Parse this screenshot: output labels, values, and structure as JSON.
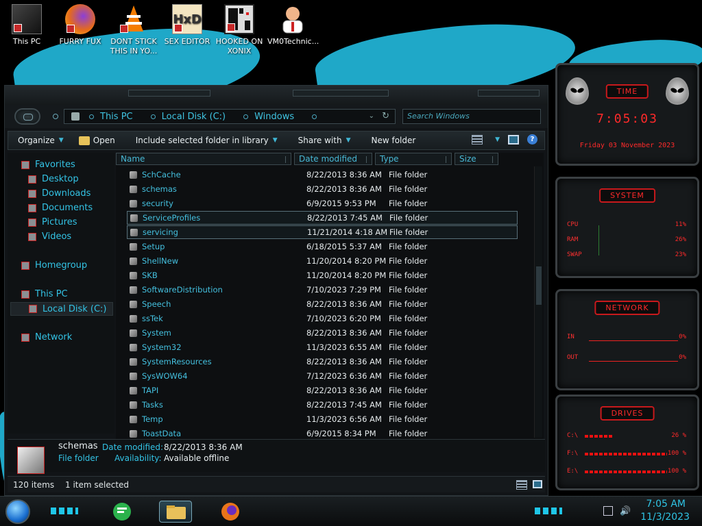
{
  "desktop": {
    "icons": [
      {
        "label": "This PC"
      },
      {
        "label": "FURRY FUX"
      },
      {
        "label": "DONT STICK THIS IN YO..."
      },
      {
        "label": "SEX EDITOR"
      },
      {
        "label": "HOOKED ON XONIX"
      },
      {
        "label": "VM0Technic..."
      }
    ]
  },
  "address": {
    "crumbs": [
      "This PC",
      "Local Disk (C:)",
      "Windows"
    ],
    "search_placeholder": "Search Windows"
  },
  "toolbar": {
    "organize": "Organize",
    "open": "Open",
    "include": "Include selected folder in library",
    "share": "Share with",
    "new_folder": "New folder",
    "help": "?"
  },
  "nav": {
    "favorites": "Favorites",
    "desktop": "Desktop",
    "downloads": "Downloads",
    "documents": "Documents",
    "pictures": "Pictures",
    "videos": "Videos",
    "homegroup": "Homegroup",
    "this_pc": "This PC",
    "local_disk": "Local Disk (C:)",
    "network": "Network"
  },
  "columns": {
    "name": "Name",
    "date": "Date modified",
    "type": "Type",
    "size": "Size"
  },
  "files": [
    {
      "name": "SchCache",
      "date": "8/22/2013 8:36 AM",
      "type": "File folder"
    },
    {
      "name": "schemas",
      "date": "8/22/2013 8:36 AM",
      "type": "File folder"
    },
    {
      "name": "security",
      "date": "6/9/2015 9:53 PM",
      "type": "File folder"
    },
    {
      "name": "ServiceProfiles",
      "date": "8/22/2013 7:45 AM",
      "type": "File folder"
    },
    {
      "name": "servicing",
      "date": "11/21/2014 4:18 AM",
      "type": "File folder"
    },
    {
      "name": "Setup",
      "date": "6/18/2015 5:37 AM",
      "type": "File folder"
    },
    {
      "name": "ShellNew",
      "date": "11/20/2014 8:20 PM",
      "type": "File folder"
    },
    {
      "name": "SKB",
      "date": "11/20/2014 8:20 PM",
      "type": "File folder"
    },
    {
      "name": "SoftwareDistribution",
      "date": "7/10/2023 7:29 PM",
      "type": "File folder"
    },
    {
      "name": "Speech",
      "date": "8/22/2013 8:36 AM",
      "type": "File folder"
    },
    {
      "name": "ssTek",
      "date": "7/10/2023 6:20 PM",
      "type": "File folder"
    },
    {
      "name": "System",
      "date": "8/22/2013 8:36 AM",
      "type": "File folder"
    },
    {
      "name": "System32",
      "date": "11/3/2023 6:55 AM",
      "type": "File folder"
    },
    {
      "name": "SystemResources",
      "date": "8/22/2013 8:36 AM",
      "type": "File folder"
    },
    {
      "name": "SysWOW64",
      "date": "7/12/2023 6:36 AM",
      "type": "File folder"
    },
    {
      "name": "TAPI",
      "date": "8/22/2013 8:36 AM",
      "type": "File folder"
    },
    {
      "name": "Tasks",
      "date": "8/22/2013 7:45 AM",
      "type": "File folder"
    },
    {
      "name": "Temp",
      "date": "11/3/2023 6:56 AM",
      "type": "File folder"
    },
    {
      "name": "ToastData",
      "date": "6/9/2015 8:34 PM",
      "type": "File folder"
    }
  ],
  "details": {
    "name": "schemas",
    "kind": "File folder",
    "date_label": "Date modified:",
    "date_value": "8/22/2013 8:36 AM",
    "avail_label": "Availability:",
    "avail_value": "Available offline"
  },
  "status": {
    "count": "120 items",
    "selected": "1 item selected"
  },
  "gadgets": {
    "time_title": "TIME",
    "time_value": "7:05:03",
    "date_value": "Friday 03 November 2023",
    "system_title": "SYSTEM",
    "cpu_label": "CPU",
    "cpu_value": "11%",
    "ram_label": "RAM",
    "ram_value": "26%",
    "swap_label": "SWAP",
    "swap_value": "23%",
    "network_title": "NETWORK",
    "in_label": "IN",
    "in_value": "0%",
    "out_label": "OUT",
    "out_value": "0%",
    "drives_title": "DRIVES",
    "drive_c_label": "C:\\",
    "drive_c_value": "26 %",
    "drive_f_label": "F:\\",
    "drive_f_value": "100 %",
    "drive_e_label": "E:\\",
    "drive_e_value": "100 %"
  },
  "taskbar": {
    "time": "7:05 AM",
    "date": "11/3/2023"
  },
  "colors": {
    "accent": "#33c3e5",
    "gadget_red": "#ff2a2a",
    "selection": "#58707a"
  }
}
